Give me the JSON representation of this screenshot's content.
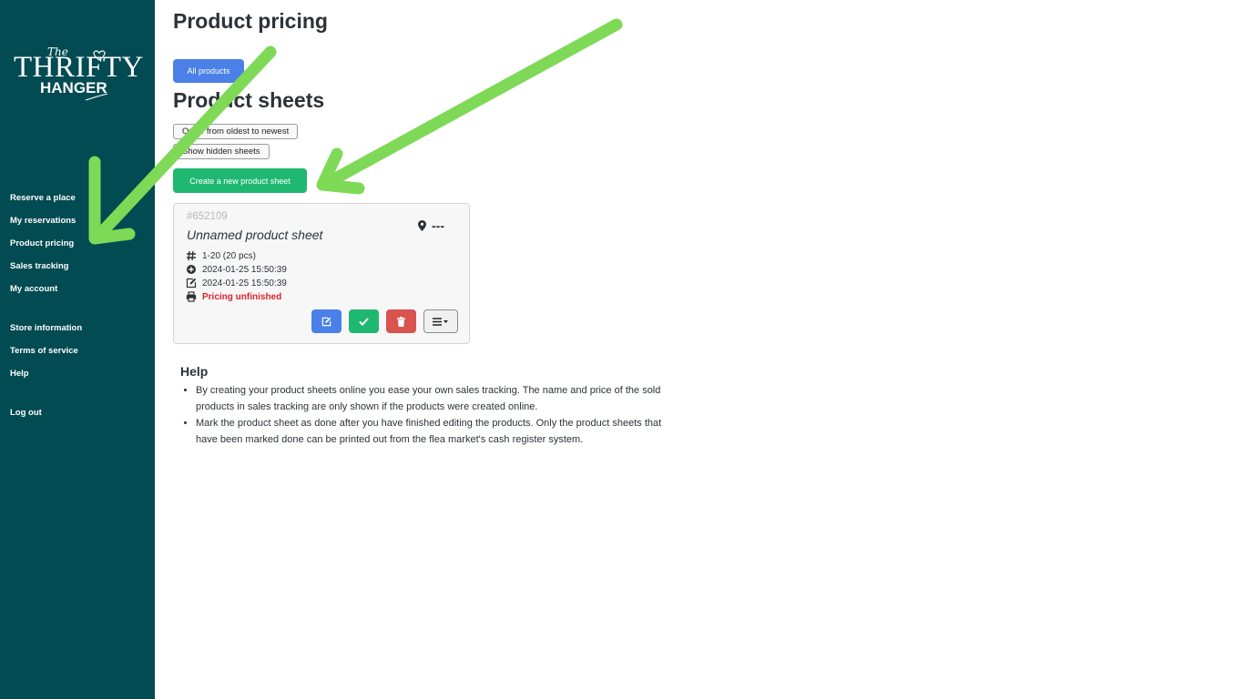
{
  "brand": {
    "logo_the": "The",
    "logo_main": "THRIFTY",
    "logo_sub": "HANGER"
  },
  "sidebar": {
    "items": [
      {
        "label": "Reserve a place"
      },
      {
        "label": "My reservations"
      },
      {
        "label": "Product pricing"
      },
      {
        "label": "Sales tracking"
      },
      {
        "label": "My account"
      },
      {
        "label": "Store information"
      },
      {
        "label": "Terms of service"
      },
      {
        "label": "Help"
      },
      {
        "label": "Log out"
      }
    ]
  },
  "main": {
    "page_title": "Product pricing",
    "all_products_label": "All products",
    "sheets_title": "Product sheets",
    "order_label": "Order from oldest to newest",
    "show_hidden_label": "Show hidden sheets",
    "create_label": "Create a new product sheet"
  },
  "sheet": {
    "id": "#652109",
    "name": "Unnamed product sheet",
    "location": "---",
    "range": "1-20 (20 pcs)",
    "created": "2024-01-25 15:50:39",
    "edited": "2024-01-25 15:50:39",
    "status": "Pricing unfinished"
  },
  "help": {
    "title": "Help",
    "items": [
      "By creating your product sheets online you ease your own sales tracking. The name and price of the sold products in sales tracking are only shown if the products were created online.",
      "Mark the product sheet as done after you have finished editing the products. Only the product sheets that have been marked done can be printed out from the flea market's cash register system."
    ]
  },
  "colors": {
    "sidebar_bg": "#034b52",
    "primary": "#4a80e8",
    "success": "#1fb870",
    "danger": "#d9534f",
    "status_text": "#d9232d",
    "annotation_arrow": "#7ed957"
  },
  "icons": {
    "location": "map-marker-icon",
    "range": "hash-icon",
    "created": "plus-circle-icon",
    "edited": "edit-icon",
    "status": "printer-icon",
    "edit_action": "edit-icon",
    "done_action": "check-icon",
    "delete_action": "trash-icon",
    "menu_action": "list-menu-icon"
  }
}
